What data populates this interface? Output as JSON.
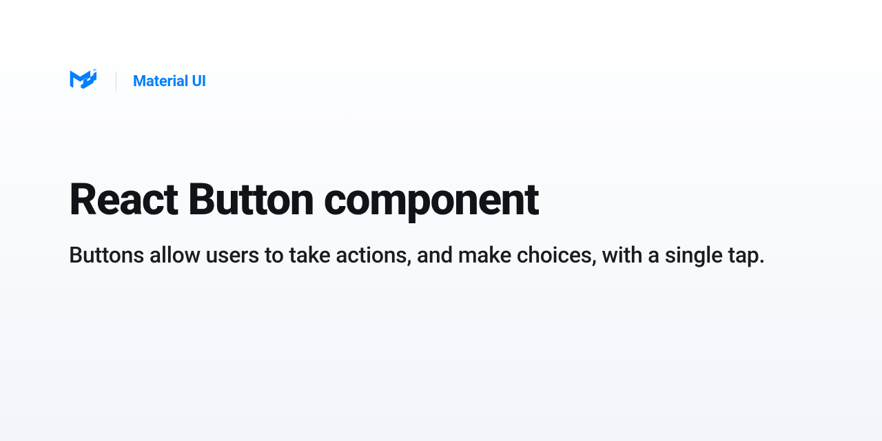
{
  "header": {
    "product_name": "Material UI"
  },
  "main": {
    "title": "React Button component",
    "subtitle": "Buttons allow users to take actions, and make choices, with a single tap."
  },
  "colors": {
    "accent": "#027ffe"
  }
}
